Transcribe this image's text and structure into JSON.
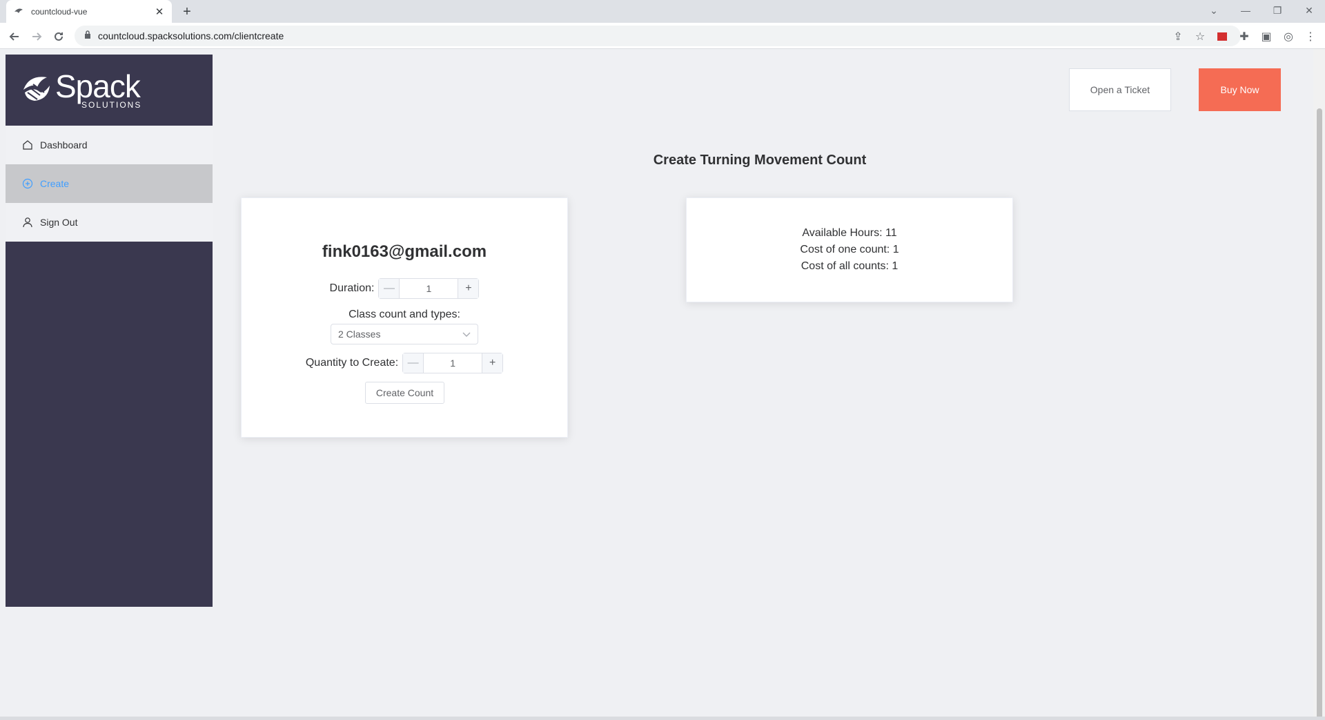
{
  "browser": {
    "tab_title": "countcloud-vue",
    "url": "countcloud.spacksolutions.com/clientcreate"
  },
  "logo": {
    "main": "Spack",
    "sub": "SOLUTIONS"
  },
  "sidebar": {
    "items": [
      {
        "label": "Dashboard",
        "icon": "home-icon"
      },
      {
        "label": "Create",
        "icon": "plus-circle-icon"
      },
      {
        "label": "Sign Out",
        "icon": "user-icon"
      }
    ]
  },
  "header": {
    "ticket_label": "Open a Ticket",
    "buy_label": "Buy Now"
  },
  "page": {
    "title": "Create Turning Movement Count"
  },
  "form": {
    "email": "fink0163@gmail.com",
    "duration_label": "Duration:",
    "duration_value": "1",
    "class_label": "Class count and types:",
    "class_value": "2 Classes",
    "quantity_label": "Quantity to Create:",
    "quantity_value": "1",
    "create_label": "Create Count"
  },
  "info": {
    "available_hours": "Available Hours: 11",
    "cost_one": "Cost of one count: 1",
    "cost_all": "Cost of all counts: 1"
  },
  "colors": {
    "sidebar_bg": "#3a384f",
    "accent": "#409eff",
    "buy_button": "#f56c54"
  }
}
